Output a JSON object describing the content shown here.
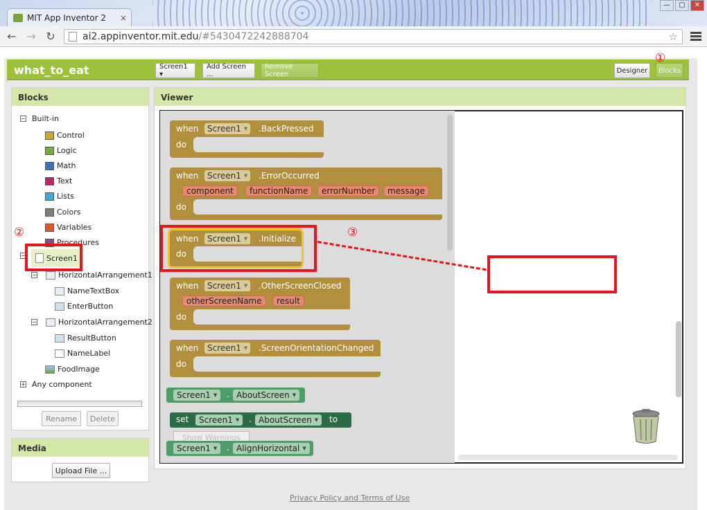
{
  "browser": {
    "tab_title": "MIT App Inventor 2",
    "tab_close": "×",
    "url_host": "ai2.appinventor.mit.edu",
    "url_path": "/#5430472242888704",
    "window_controls": [
      "—",
      "▢",
      "✕"
    ]
  },
  "app": {
    "project_name": "what_to_eat",
    "screen_select": "Screen1 ▾",
    "add_screen": "Add Screen ...",
    "remove_screen": "Remove Screen",
    "designer": "Designer",
    "blocks": "Blocks"
  },
  "blocks_panel": {
    "title": "Blocks",
    "builtin": {
      "label": "Built-in",
      "items": [
        {
          "label": "Control",
          "color": "#c9a43a"
        },
        {
          "label": "Logic",
          "color": "#77ab41"
        },
        {
          "label": "Math",
          "color": "#3f71b5"
        },
        {
          "label": "Text",
          "color": "#b32d5e"
        },
        {
          "label": "Lists",
          "color": "#49a6d4"
        },
        {
          "label": "Colors",
          "color": "#7d7d7d"
        },
        {
          "label": "Variables",
          "color": "#d05f2d"
        },
        {
          "label": "Procedures",
          "color": "#7c5385"
        }
      ]
    },
    "screen1": "Screen1",
    "components": [
      "HorizontalArrangement1",
      "NameTextBox",
      "EnterButton",
      "HorizontalArrangement2",
      "ResultButton",
      "NameLabel",
      "FoodImage"
    ],
    "any_component": "Any component",
    "rename": "Rename",
    "delete": "Delete"
  },
  "media_panel": {
    "title": "Media",
    "upload": "Upload File ..."
  },
  "viewer": {
    "title": "Viewer",
    "kw_when": "when",
    "kw_do": "do",
    "kw_set": "set",
    "kw_to": "to",
    "dot": ".",
    "screen": "Screen1",
    "events": [
      {
        "name": ".BackPressed",
        "params": []
      },
      {
        "name": ".ErrorOccurred",
        "params": [
          "component",
          "functionName",
          "errorNumber",
          "message"
        ]
      },
      {
        "name": ".Initialize",
        "params": []
      },
      {
        "name": ".OtherScreenClosed",
        "params": [
          "otherScreenName",
          "result"
        ]
      },
      {
        "name": ".ScreenOrientationChanged",
        "params": []
      }
    ],
    "prop_about": "AboutScreen",
    "prop_align": "AlignHorizontal",
    "show_warnings": "Show Warnings"
  },
  "annotations": {
    "one": "①",
    "two": "②",
    "three": "③"
  },
  "footer": {
    "link": "Privacy Policy and Terms of Use"
  },
  "colors": {
    "accent_green": "#9bc23a",
    "event_block": "#b18f3c",
    "highlight": "#f2c12e",
    "annotation_red": "#e8141a",
    "component_block": "#4f9c68"
  }
}
